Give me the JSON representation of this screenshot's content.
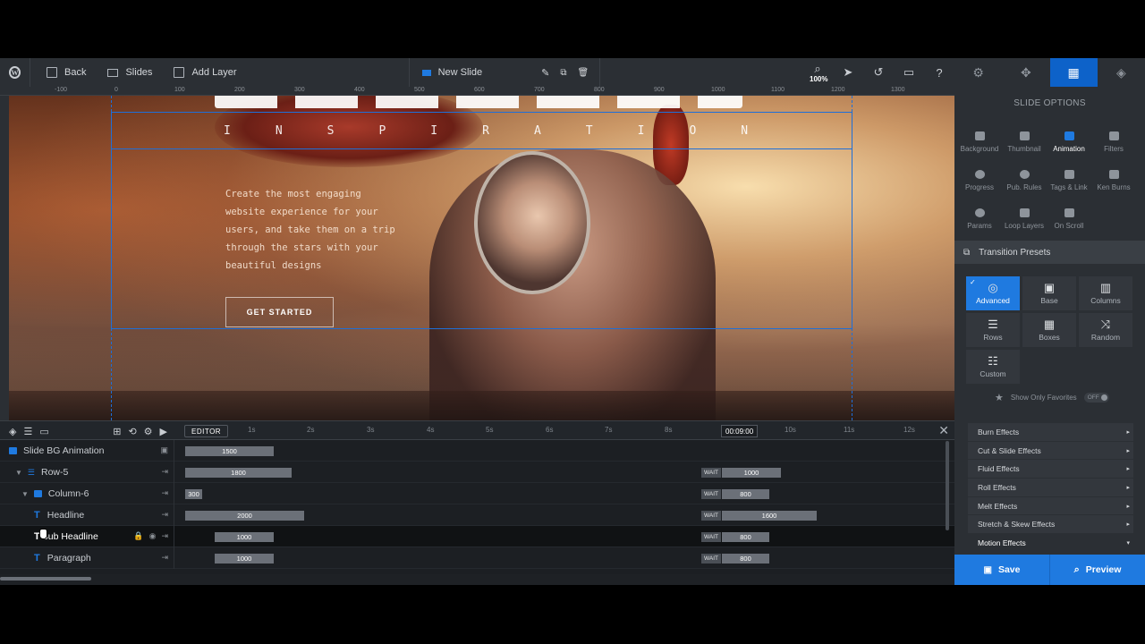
{
  "toolbar": {
    "back_label": "Back",
    "slides_label": "Slides",
    "add_layer_label": "Add Layer",
    "slide_name": "New Slide",
    "zoom": "100%"
  },
  "ruler": {
    "ticks": [
      "-100",
      "0",
      "100",
      "200",
      "300",
      "400",
      "500",
      "600",
      "700",
      "800",
      "900",
      "1000",
      "1100",
      "1200",
      "1300"
    ]
  },
  "slide": {
    "subheadline": "INSPIRATION",
    "paragraph": "Create the most engaging website experience for your users, and take them on a trip through the stars with your beautiful designs",
    "cta_label": "GET STARTED"
  },
  "timeline": {
    "editor_label": "EDITOR",
    "time_ticks": [
      "1s",
      "2s",
      "3s",
      "4s",
      "5s",
      "6s",
      "7s",
      "8s",
      "10s",
      "11s",
      "12s"
    ],
    "playhead": "00:09:00",
    "wait_label": "WAIT",
    "rows": [
      {
        "name": "Slide BG Animation",
        "start": "1500",
        "end": ""
      },
      {
        "name": "Row-5",
        "start": "1800",
        "end": "1000"
      },
      {
        "name": "Column-6",
        "start": "300",
        "end": "800"
      },
      {
        "name": "Headline",
        "start": "2000",
        "end": "1600"
      },
      {
        "name": "Sub Headline",
        "start": "1000",
        "end": "800"
      },
      {
        "name": "Paragraph",
        "start": "1000",
        "end": "800"
      }
    ]
  },
  "right_panel": {
    "title": "SLIDE OPTIONS",
    "options": [
      "Background",
      "Thumbnail",
      "Animation",
      "Filters",
      "Progress",
      "Pub. Rules",
      "Tags & Link",
      "Ken Burns",
      "Params",
      "Loop Layers",
      "On Scroll"
    ],
    "active_option": "Animation",
    "section_title": "Transition Presets",
    "presets": [
      "Advanced",
      "Base",
      "Columns",
      "Rows",
      "Boxes",
      "Random",
      "Custom"
    ],
    "active_preset": "Advanced",
    "favorites_label": "Show Only Favorites",
    "favorites_toggle": "OFF",
    "effects": [
      "Burn Effects",
      "Cut & Slide Effects",
      "Fluid Effects",
      "Roll Effects",
      "Melt Effects",
      "Stretch & Skew Effects",
      "Motion Effects"
    ],
    "save_label": "Save",
    "preview_label": "Preview"
  },
  "colors": {
    "accent": "#1f7ae0",
    "toolbar_bg": "#2b2f34",
    "timeline_bg": "#1c1f23"
  }
}
